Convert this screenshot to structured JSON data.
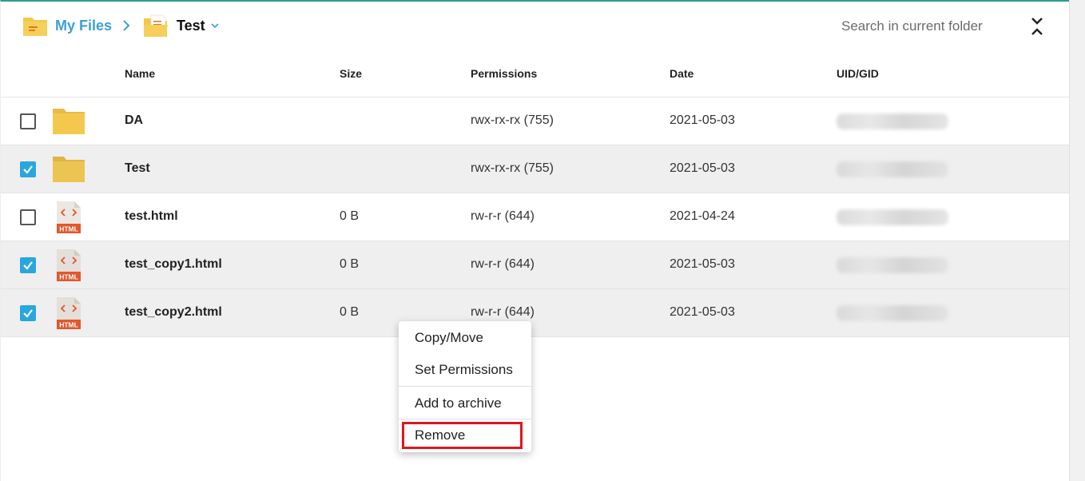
{
  "breadcrumb": {
    "root_label": "My Files",
    "current_label": "Test"
  },
  "search": {
    "placeholder": "Search in current folder"
  },
  "columns": {
    "name": "Name",
    "size": "Size",
    "permissions": "Permissions",
    "date": "Date",
    "uid": "UID/GID"
  },
  "rows": [
    {
      "name": "DA",
      "type": "folder",
      "size": "",
      "permissions": "rwx-rx-rx (755)",
      "date": "2021-05-03",
      "checked": false
    },
    {
      "name": "Test",
      "type": "folder",
      "size": "",
      "permissions": "rwx-rx-rx (755)",
      "date": "2021-05-03",
      "checked": true
    },
    {
      "name": "test.html",
      "type": "html",
      "size": "0 B",
      "permissions": "rw-r-r (644)",
      "date": "2021-04-24",
      "checked": false
    },
    {
      "name": "test_copy1.html",
      "type": "html",
      "size": "0 B",
      "permissions": "rw-r-r (644)",
      "date": "2021-05-03",
      "checked": true
    },
    {
      "name": "test_copy2.html",
      "type": "html",
      "size": "0 B",
      "permissions": "rw-r-r (644)",
      "date": "2021-05-03",
      "checked": true
    }
  ],
  "context_menu": {
    "copy_move": "Copy/Move",
    "set_permissions": "Set Permissions",
    "add_to_archive": "Add to archive",
    "remove": "Remove"
  },
  "file_badge": "HTML",
  "colors": {
    "accent": "#3aa0d8",
    "checkbox": "#2aa6df",
    "folder": "#f2c94c",
    "html_badge": "#e2572b",
    "highlight": "#e0161d"
  },
  "icons": {
    "root": "folder-icon",
    "separator": "chevron-right-icon",
    "current": "folder-open-icon",
    "dropdown": "chevron-down-icon",
    "collapse": "collapse-icon"
  }
}
